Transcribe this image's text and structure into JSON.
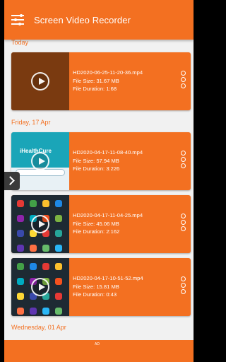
{
  "app": {
    "title": "Screen Video Recorder"
  },
  "sections": [
    {
      "label": "Today"
    },
    {
      "label": "Friday, 17 Apr"
    },
    {
      "label": "Wednesday, 01 Apr"
    }
  ],
  "videos": [
    {
      "name": "HD2020-06-25-11-20-36.mp4",
      "size": "File Size: 31.67 MB",
      "duration": "File Duration: 1:68",
      "thumb": "dark-orange"
    },
    {
      "name": "HD2020-04-17-11-08-40.mp4",
      "size": "File Size: 57.94 MB",
      "duration": "File Duration: 3:226",
      "thumb": "healthcure-app"
    },
    {
      "name": "HD2020-04-17-11-04-25.mp4",
      "size": "File Size: 45.06 MB",
      "duration": "File Duration: 2:162",
      "thumb": "home-screen-apps"
    },
    {
      "name": "HD2020-04-17-10-51-52.mp4",
      "size": "File Size: 15.81 MB",
      "duration": "File Duration: 0:43",
      "thumb": "home-screen-apps"
    }
  ],
  "thumb_text": {
    "healthcure": "iHealthCure"
  },
  "ad": {
    "label": "AD"
  },
  "colors": {
    "accent": "#f37021",
    "background": "#f1f1f1"
  },
  "icons": {
    "menu": "sliders-menu-icon",
    "play": "play-icon",
    "more": "more-vertical-icon",
    "nav": "chevron-right-icon"
  }
}
